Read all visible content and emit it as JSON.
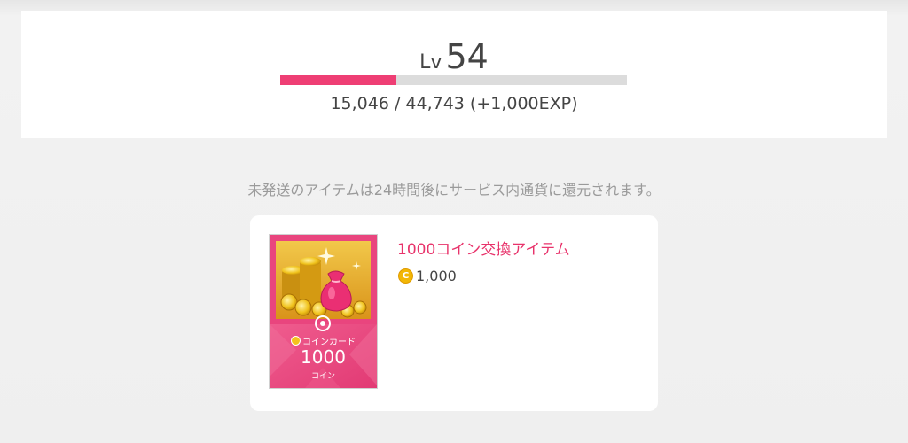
{
  "level": {
    "prefix": "Lv",
    "value": "54",
    "progress_fraction": 0.336,
    "exp_text": "15,046 / 44,743 (+1,000EXP)"
  },
  "notice": "未発送のアイテムは24時間後にサービス内通貨に還元されます。",
  "item": {
    "title": "1000コイン交換アイテム",
    "price": "1,000",
    "coin_symbol": "C",
    "card": {
      "caption": "コインカード",
      "amount": "1000",
      "unit": "コイン"
    }
  },
  "icons": {
    "coin": "coin-icon",
    "coin_pile": "coin-pile-icon",
    "bag": "money-bag-icon"
  },
  "colors": {
    "accent": "#ee3e74",
    "title": "#e8336b",
    "bar_bg": "#dcdcdc",
    "coin": "#f2b705"
  }
}
